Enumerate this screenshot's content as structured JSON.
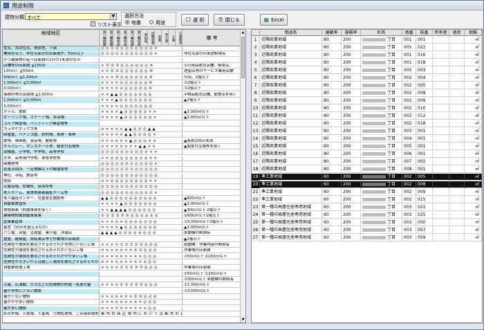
{
  "window": {
    "title": "用途制限"
  },
  "toolbar": {
    "building_label": "建物分類:",
    "building_value": "すべて",
    "list_display_label": "リスト表示",
    "list_display_checked": true,
    "selection_group_label": "選択方法",
    "radio_lot": "地番",
    "radio_use": "用途",
    "select_button": "選 択",
    "close_button": "閉じる",
    "excel_button": "Excel"
  },
  "left_table": {
    "header_category": "地域地区",
    "header_note": "備 考",
    "zone_headers": [
      "第一種低層",
      "第二種低層",
      "第一種中高",
      "第二種中高",
      "第一種住居",
      "第二種住居",
      "準住居",
      "近隣商業",
      "商業",
      "準工業",
      "工業",
      "工業専用"
    ],
    "rows": [
      {
        "cat": "住宅、共同住宅、寄宿舎、下宿",
        "syms": "◎◎◎◎◎◎◎◎◎◎◎×",
        "note": ""
      },
      {
        "cat": "兼用住宅で、非住宅部分の床面積が、50㎡以下",
        "syms": "◎◎◎◎◎◎◎◎◎◎◎×",
        "note": "非住宅部分の用途制限有"
      },
      {
        "cat": "かつ建築物の延べ床面積の2分の1未満のもの",
        "syms": "",
        "note": ""
      },
      {
        "cat": "店舗等の床面積 ≦150㎡",
        "syms": "×①②③◎◎◎◎◎◎④",
        "note": "①日用品販売店舗、喫茶店、"
      },
      {
        "cat": "150㎡＜ ≦500㎡",
        "syms": "××②③◎◎◎◎◎◎④",
        "note": "理髪店等のサービス業用店舗"
      },
      {
        "cat": "500㎡＜ ≦1,500㎡",
        "syms": "×××③◎◎◎◎◎◎④",
        "note": "のみ。2階以下"
      },
      {
        "cat": "1,500㎡＜ ≦3,000㎡",
        "syms": "××××◎◎◎◎◎◎④",
        "note": "②2階以下"
      },
      {
        "cat": "3,000㎡＜",
        "syms": "×××××◎◎◎◎◎④",
        "note": "③2階以下"
      },
      {
        "cat": "事務所等の床面積 ≦1,500㎡",
        "syms": "××▲▲◎◎◎◎◎◎◎",
        "note": "④物品販売店舗、飲食店を除く"
      },
      {
        "cat": "1,500㎡＜ ≦3,000㎡",
        "syms": "×××▲◎◎◎◎◎◎◎",
        "note": "▲2階以下"
      },
      {
        "cat": "3,000㎡＜",
        "syms": "××××◎◎◎◎◎◎◎",
        "note": ""
      },
      {
        "cat": "ホテル、旅館",
        "syms": "××××▲◎◎◎◎◎××",
        "note": "▲3,000㎡以下"
      },
      {
        "cat": "ボーリング場、スケート場、水泳場",
        "syms": "××××▲◎◎◎◎◎◎×",
        "note": "▲3,000㎡以下"
      },
      {
        "cat": "ゴルフ練習場、バッティング練習場等",
        "syms": "",
        "note": ""
      },
      {
        "cat": "カラオケボックス等",
        "syms": "×××××▲▲◎◎◎▲▲",
        "note": ""
      },
      {
        "cat": "麻雀屋、パチンコ屋、射的場、馬券・車券",
        "syms": "×××××▲▲◎◎◎◎×",
        "note": ""
      },
      {
        "cat": "劇場、映画館、演芸場、観覧場",
        "syms": "××××××▲◎◎◎××",
        "note": "▲客席200㎡未満"
      },
      {
        "cat": "キャバレー、ダンスホール等、個室付浴場等",
        "syms": "××××××××▲▲××",
        "note": "▲個室付浴場等を除く"
      },
      {
        "cat": "幼稚園、小学校、中学校、高等学校",
        "syms": "◎◎◎◎◎◎◎◎◎◎××",
        "note": ""
      },
      {
        "cat": "大学、高等専門学校、専修学校等",
        "syms": "××◎◎◎◎◎◎◎◎××",
        "note": ""
      },
      {
        "cat": "図書館等",
        "syms": "◎◎◎◎◎◎◎◎◎◎◎×",
        "note": ""
      },
      {
        "cat": "巡査派出所、一定規模以下の郵便局等",
        "syms": "◎◎◎◎◎◎◎◎◎◎◎◎",
        "note": ""
      },
      {
        "cat": "神社、寺院、教会等",
        "syms": "◎◎◎◎◎◎◎◎◎◎◎◎",
        "note": ""
      },
      {
        "cat": "病院",
        "syms": "××◎◎◎◎◎◎◎◎××",
        "note": ""
      },
      {
        "cat": "公衆浴場、診療所、保育所等",
        "syms": "◎◎◎◎◎◎◎◎◎◎◎◎",
        "note": ""
      },
      {
        "cat": "老人ホーム、身体障害者福祉ホーム等",
        "syms": "◎◎◎◎◎◎◎◎◎◎◎×",
        "note": ""
      },
      {
        "cat": "老人福祉センター、児童厚生施設等",
        "syms": "▲▲◎◎◎◎◎◎◎◎◎◎",
        "note": "▲600㎡以下"
      },
      {
        "cat": "自動車教習所",
        "syms": "××××▲◎◎◎◎◎◎◎",
        "note": "▲3,000㎡以下"
      },
      {
        "cat": "単独車庫（附属車庫を除く）",
        "syms": "××▲▲▲▲◎◎◎◎◎◎",
        "note": "▲300㎡以下 2階以下"
      },
      {
        "cat": "建築物附属自動車車庫",
        "syms": "①①②②③③◎◎◎◎◎◎",
        "note": "①600㎡以下1階以下"
      },
      {
        "cat": "倉庫業倉庫",
        "syms": "×××××◎◎◎◎◎◎◎",
        "note": "②3,000㎡以下2階以下"
      },
      {
        "cat": "畜舎（15㎡を超えるもの）",
        "syms": "××××▲◎◎◎◎◎◎◎",
        "note": "▲3,000㎡以下"
      },
      {
        "cat": "パン屋、米屋、豆腐屋、菓子屋、洋服店",
        "syms": "▲▲▲▲◎◎◎◎◎◎◎◎",
        "note": "原動機の制限有"
      },
      {
        "cat": "畳屋、建具屋、自転車店等で作業場の床面積",
        "syms": "",
        "note": "▲2階以下"
      },
      {
        "cat": "危険性や環境を悪化させるおそれが非常に少ない工場",
        "syms": "××××①①①②②◎◎◎",
        "note": "原動機・作業内容の制限有"
      },
      {
        "cat": "危険性や環境を悪化させるおそれが少ない工場",
        "syms": "×××××××②②◎◎◎",
        "note": "作業場の床面積"
      },
      {
        "cat": "危険性や環境を悪化させるおそれがやや多い工場",
        "syms": "×××××××××◎◎◎",
        "note": "①50㎡以下 ②150㎡以下"
      },
      {
        "cat": "危険性が大きいか又は著しく環境を悪化させるおそれがある工場",
        "syms": "××××××××××◎◎",
        "note": ""
      },
      {
        "cat": "自動車修理工場",
        "syms": "××××①①②③③◎◎◎",
        "note": "作業場の床面積"
      },
      {
        "cat": "",
        "syms": "",
        "note": "①50㎡以下 ②150㎡以下"
      },
      {
        "cat": "",
        "syms": "",
        "note": "③300㎡以下 原動機の制限有"
      },
      {
        "cat": "火薬、石油類、ガスなどの危険物の貯蔵・処理の量",
        "syms": "××××①①①②②◎◎◎",
        "note": "①1,500㎡以下"
      },
      {
        "cat": "量が非常に少ない施設",
        "syms": "",
        "note": "②3,000㎡以下"
      },
      {
        "cat": "量が少ない施設",
        "syms": "×××××××②②◎◎◎",
        "note": ""
      },
      {
        "cat": "量がやや多い施設",
        "syms": "×××××××××◎◎◎",
        "note": ""
      },
      {
        "cat": "量が多い施設",
        "syms": "××××××××××◎◎",
        "note": ""
      },
      {
        "cat": "卸売市場、火葬場、と畜場、汚物処理場、ごみ焼却場等",
        "syms": "都市計画区域内においては都市計画決定が必要",
        "note": ""
      }
    ]
  },
  "right_table": {
    "headers": [
      "用途名",
      "建蔽率",
      "容積率",
      "町名",
      "地番",
      "枝番",
      "所有者",
      "地目",
      "地積"
    ],
    "rows": [
      {
        "no": "1",
        "use": "近隣商業地域",
        "bc": "80",
        "fr": "200",
        "town": "丁目",
        "lot": "001",
        "branch": "001",
        "unit": "㎡"
      },
      {
        "no": "2",
        "use": "近隣商業地域",
        "bc": "80",
        "fr": "200",
        "town": "丁目",
        "lot": "001",
        "branch": "022",
        "unit": "㎡"
      },
      {
        "no": "3",
        "use": "近隣商業地域",
        "bc": "80",
        "fr": "200",
        "town": "丁目",
        "lot": "001",
        "branch": "016",
        "unit": "㎡"
      },
      {
        "no": "4",
        "use": "近隣商業地域",
        "bc": "80",
        "fr": "200",
        "town": "丁目",
        "lot": "001",
        "branch": "018",
        "unit": "㎡"
      },
      {
        "no": "5",
        "use": "近隣商業地域",
        "bc": "80",
        "fr": "200",
        "town": "丁目",
        "lot": "002",
        "branch": "003",
        "unit": "㎡"
      },
      {
        "no": "6",
        "use": "近隣商業地域",
        "bc": "80",
        "fr": "200",
        "town": "丁目",
        "lot": "002",
        "branch": "004",
        "unit": "㎡"
      },
      {
        "no": "7",
        "use": "近隣商業地域",
        "bc": "80",
        "fr": "200",
        "town": "丁目",
        "lot": "002",
        "branch": "005",
        "unit": "㎡"
      },
      {
        "no": "8",
        "use": "近隣商業地域",
        "bc": "80",
        "fr": "200",
        "town": "丁目",
        "lot": "002",
        "branch": "008",
        "unit": "㎡"
      },
      {
        "no": "9",
        "use": "近隣商業地域",
        "bc": "80",
        "fr": "200",
        "town": "丁目",
        "lot": "002",
        "branch": "009",
        "unit": "㎡"
      },
      {
        "no": "10",
        "use": "近隣商業地域",
        "bc": "80",
        "fr": "200",
        "town": "丁目",
        "lot": "002",
        "branch": "010",
        "unit": "㎡"
      },
      {
        "no": "11",
        "use": "近隣商業地域",
        "bc": "80",
        "fr": "200",
        "town": "丁目",
        "lot": "002",
        "branch": "012",
        "unit": "㎡"
      },
      {
        "no": "12",
        "use": "近隣商業地域",
        "bc": "80",
        "fr": "200",
        "town": "丁目",
        "lot": "002",
        "branch": "018",
        "unit": "㎡"
      },
      {
        "no": "13",
        "use": "近隣商業地域",
        "bc": "80",
        "fr": "200",
        "town": "丁目",
        "lot": "003",
        "branch": "001",
        "unit": "㎡"
      },
      {
        "no": "14",
        "use": "近隣商業地域",
        "bc": "80",
        "fr": "200",
        "town": "丁目",
        "lot": "004",
        "branch": "001",
        "unit": "㎡"
      },
      {
        "no": "15",
        "use": "近隣商業地域",
        "bc": "80",
        "fr": "200",
        "town": "丁目",
        "lot": "005",
        "branch": "001",
        "unit": "㎡"
      },
      {
        "no": "16",
        "use": "近隣商業地域",
        "bc": "80",
        "fr": "200",
        "town": "丁目",
        "lot": "006",
        "branch": "001",
        "unit": "㎡"
      },
      {
        "no": "17",
        "use": "近隣商業地域",
        "bc": "80",
        "fr": "200",
        "town": "丁目",
        "lot": "007",
        "branch": "002",
        "unit": "㎡"
      },
      {
        "no": "18",
        "use": "近隣商業地域",
        "bc": "80",
        "fr": "200",
        "town": "丁目",
        "lot": "008",
        "branch": "001",
        "unit": "㎡"
      },
      {
        "no": "19",
        "use": "準工業地域",
        "bc": "60",
        "fr": "200",
        "town": "丁目",
        "lot": "002",
        "branch": "005",
        "unit": "㎡",
        "sel": true
      },
      {
        "no": "20",
        "use": "準工業地域",
        "bc": "60",
        "fr": "200",
        "town": "丁目",
        "lot": "002",
        "branch": "008",
        "unit": "㎡",
        "sel": true
      },
      {
        "no": "21",
        "use": "準工業地域",
        "bc": "60",
        "fr": "200",
        "town": "丁目",
        "lot": "002",
        "branch": "009",
        "unit": "㎡"
      },
      {
        "no": "22",
        "use": "準工業地域",
        "bc": "60",
        "fr": "200",
        "town": "丁目",
        "lot": "002",
        "branch": "015",
        "unit": "㎡"
      },
      {
        "no": "23",
        "use": "第一種中高層住居専用地域",
        "bc": "60",
        "fr": "200",
        "town": "丁目",
        "lot": "003",
        "branch": "021",
        "unit": "㎡"
      },
      {
        "no": "24",
        "use": "第一種中高層住居専用地域",
        "bc": "60",
        "fr": "200",
        "town": "丁目",
        "lot": "003",
        "branch": "025",
        "unit": "㎡"
      },
      {
        "no": "25",
        "use": "第一種中高層住居専用地域",
        "bc": "60",
        "fr": "200",
        "town": "丁目",
        "lot": "003",
        "branch": "050",
        "unit": "㎡"
      },
      {
        "no": "26",
        "use": "第一種中高層住居専用地域",
        "bc": "60",
        "fr": "200",
        "town": "丁目",
        "lot": "003",
        "branch": "057",
        "unit": "㎡"
      },
      {
        "no": "27",
        "use": "第一種中高層住居専用地域",
        "bc": "60",
        "fr": "200",
        "town": "丁目",
        "lot": "003",
        "branch": "059",
        "unit": "㎡"
      }
    ]
  }
}
